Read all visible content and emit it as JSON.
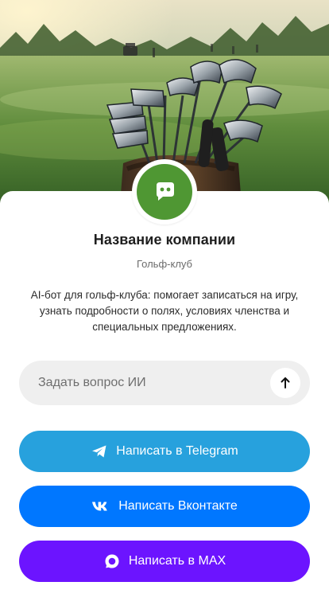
{
  "hero": {
    "image_icon": "golf-course-with-clubs-photo"
  },
  "profile": {
    "avatar_icon": "chat-bot-icon",
    "avatar_color": "#4f9733",
    "name": "Название компании",
    "subtitle": "Гольф-клуб",
    "description": "AI-бот для гольф-клуба: помогает записаться на игру, узнать подробности о полях, условиях членства и специальных предложениях."
  },
  "ask": {
    "placeholder": "Задать вопрос ИИ",
    "value": "",
    "send_icon": "arrow-up-icon"
  },
  "actions": [
    {
      "label": "Написать в Telegram",
      "icon": "telegram-icon",
      "color": "#27a1dd"
    },
    {
      "label": "Написать Вконтакте",
      "icon": "vk-icon",
      "color": "#0077ff"
    },
    {
      "label": "Написать в MAX",
      "icon": "max-icon",
      "color": "#6c14ff"
    }
  ]
}
